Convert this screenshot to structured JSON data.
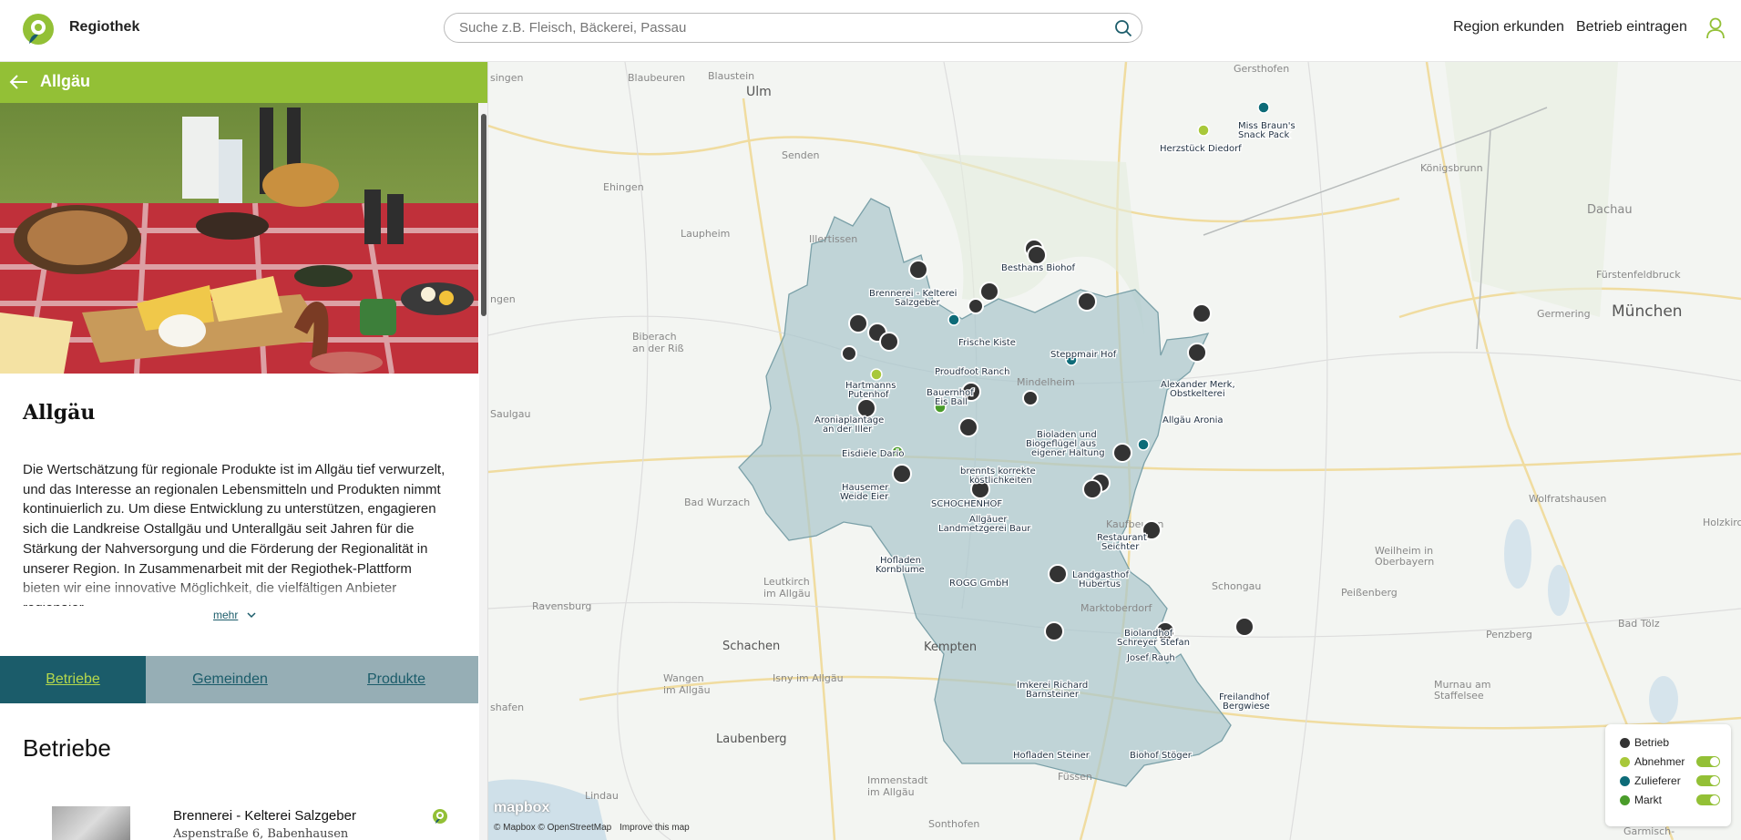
{
  "header": {
    "brand": "Regiothek",
    "search_placeholder": "Suche z.B. Fleisch, Bäckerei, Passau",
    "nav": [
      "Region erkunden",
      "Betrieb eintragen"
    ]
  },
  "panel": {
    "back_title": "Allgäu",
    "region_title": "Allgäu",
    "description": "Die Wertschätzung für regionale Produkte ist im Allgäu tief verwurzelt, und das Interesse an regionalen Lebensmitteln und Produkten nimmt kontinuierlich zu. Um diese Entwicklung zu unterstützen, engagieren sich die Landkreise Ostallgäu und Unterallgäu seit Jahren für die Stärkung der Nahversorgung und die Förderung der Regionalität in unserer Region. In Zusammenarbeit mit der Regiothek-Plattform bieten wir eine innovative Möglichkeit, die vielfältigen Anbieter regionaler",
    "more_label": "mehr",
    "tabs": [
      {
        "label": "Betriebe",
        "active": true
      },
      {
        "label": "Gemeinden",
        "active": false
      },
      {
        "label": "Produkte",
        "active": false
      }
    ],
    "section_title": "Betriebe",
    "list": [
      {
        "name": "Brennerei - Kelterei Salzgeber",
        "address": "Aspenstraße 6, Babenhausen"
      }
    ]
  },
  "map": {
    "places": [
      "singen",
      "Blaubeuren",
      "Blaustein",
      "Ulm",
      "Gersthofen",
      "Senden",
      "Ehingen",
      "Königsbrunn",
      "Dachau",
      "Laupheim",
      "Illertissen",
      "Fürstenfeldbruck",
      "München",
      "Germering",
      "ngen",
      "Biberach an der Riß",
      "Mindelheim",
      "Saulgau",
      "Bad Wurzach",
      "Leutkirch im Allgäu",
      "Kaufbeuren",
      "Weilheim in Oberbayern",
      "Wolfratshausen",
      "Holzkirchen",
      "Ravensburg",
      "Schongau",
      "Peißenberg",
      "Marktoberdorf",
      "Schachen",
      "Kempten",
      "Wangen im Allgäu",
      "Isny im Allgäu",
      "Penzberg",
      "Bad Tölz",
      "shafen",
      "Laubenberg",
      "Murnau am Staffelsee",
      "Lindau",
      "Immenstadt im Allgäu",
      "Füssen",
      "Sonthofen",
      "Garmisch-"
    ],
    "markers": [
      "Miss Braun's Snack Pack",
      "Herzstück Diedorf",
      "Besthans Biohof",
      "Brennerei - Kelterei Salzgeber",
      "Frische Kiste",
      "Steppmair Hof",
      "Proudfoot Ranch",
      "Alexander Merk, Obstkelterei",
      "Hartmanns Putenhof",
      "Bauernhof Eis Ball",
      "Aroniaplantage an der Iller",
      "Allgäu Aronia",
      "Bioladen und Biogeflügel aus eigener Haltung",
      "Eisdiele Dario",
      "brennts korrekte köstlichkeiten",
      "Hausemer Weide Eier",
      "SCHOCHENHOF",
      "Allgäuer Landmetzgerei Baur",
      "Restaurant Seichter",
      "Hofladen Kornblume",
      "ROGG GmbH",
      "Landgasthof Hubertus",
      "Biolandhof Schreyer Stefan",
      "Josef Rauh",
      "Imkerei Richard Barnsteiner",
      "Freilandhof Bergwiese",
      "Hofladen Steiner",
      "Biohof Stöger"
    ],
    "attribution": "© Mapbox © OpenStreetMap",
    "improve": "Improve this map",
    "mapbox": "mapbox",
    "legend": [
      {
        "label": "Betrieb",
        "color": "#333333",
        "toggle": false
      },
      {
        "label": "Abnehmer",
        "color": "#a8c83a",
        "toggle": true
      },
      {
        "label": "Zulieferer",
        "color": "#0d6b78",
        "toggle": true
      },
      {
        "label": "Markt",
        "color": "#4a9c2a",
        "toggle": true
      }
    ]
  },
  "colors": {
    "brand_green": "#93c036",
    "brand_teal": "#1b5c6a",
    "region_fill": "#a9c6cc"
  }
}
